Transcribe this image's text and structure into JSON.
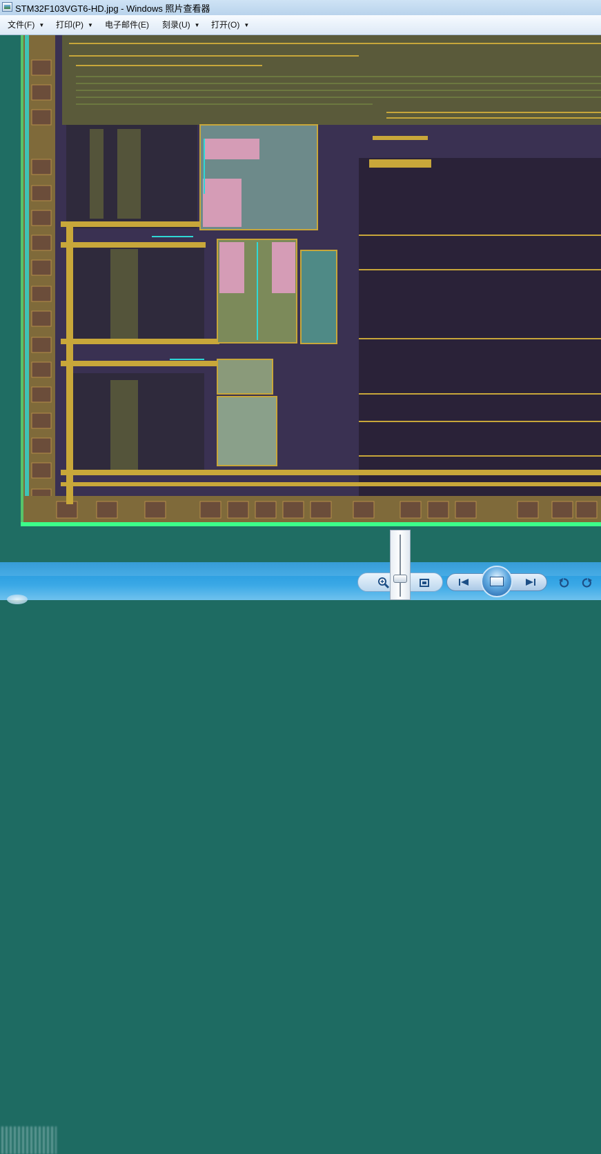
{
  "window": {
    "title": "STM32F103VGT6-HD.jpg - Windows 照片查看器",
    "icon": "photo-viewer-icon"
  },
  "menu": {
    "items": [
      {
        "label": "文件(F)",
        "has_dropdown": true
      },
      {
        "label": "打印(P)",
        "has_dropdown": true
      },
      {
        "label": "电子邮件(E)",
        "has_dropdown": false
      },
      {
        "label": "刻录(U)",
        "has_dropdown": true
      },
      {
        "label": "打开(O)",
        "has_dropdown": true
      }
    ],
    "dropdown_glyph": "▼"
  },
  "image": {
    "subject": "STM32F103VGT6 die photograph",
    "colors": {
      "background": "#1f6d63",
      "die_dark": "#2a2238",
      "metal_gold": "#c8a73a",
      "pad_brown": "#6b4d3a",
      "pink_block": "#d59cb6",
      "cyan_line": "#2fd9d6",
      "green_seal": "#3cff8a"
    }
  },
  "toolbar": {
    "zoom_icon": "magnifier-zoom-icon",
    "actual_size_icon": "actual-size-icon",
    "previous_icon": "previous-icon",
    "slideshow_icon": "slideshow-icon",
    "next_icon": "next-icon",
    "rotate_ccw_icon": "rotate-counterclockwise-icon",
    "rotate_cw_icon": "rotate-clockwise-icon",
    "zoom_level": 0.7
  }
}
